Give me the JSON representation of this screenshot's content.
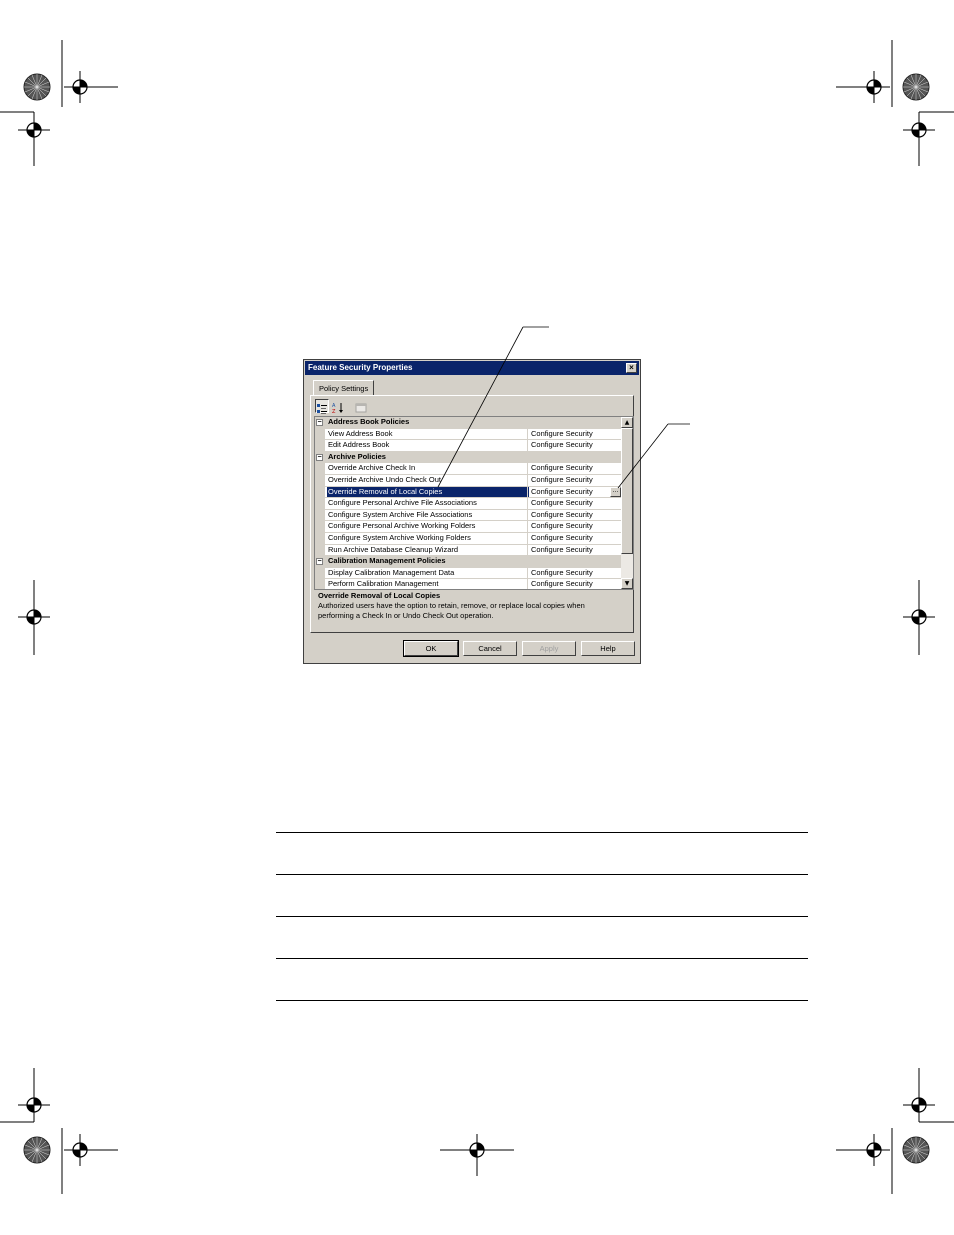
{
  "dialog": {
    "title": "Feature Security Properties",
    "close_glyph": "×",
    "tab_label": "Policy Settings",
    "toolbar": [
      {
        "icon": "categorized-view-icon",
        "active": true
      },
      {
        "icon": "alphabetical-sort-icon",
        "active": false
      },
      {
        "icon": "property-pages-icon",
        "active": false
      }
    ],
    "rows": [
      {
        "type": "category",
        "label": "Address Book Policies",
        "expander": "−"
      },
      {
        "type": "item",
        "label": "View Address Book",
        "value": "Configure Security"
      },
      {
        "type": "item",
        "label": "Edit Address Book",
        "value": "Configure Security"
      },
      {
        "type": "category",
        "label": "Archive Policies",
        "expander": "−"
      },
      {
        "type": "item",
        "label": "Override Archive Check In",
        "value": "Configure Security"
      },
      {
        "type": "item",
        "label": "Override Archive Undo Check Out",
        "value": "Configure Security"
      },
      {
        "type": "item",
        "label": "Override Removal of Local Copies",
        "value": "Configure Security",
        "selected": true
      },
      {
        "type": "item",
        "label": "Configure Personal Archive File Associations",
        "value": "Configure Security"
      },
      {
        "type": "item",
        "label": "Configure System Archive File Associations",
        "value": "Configure Security"
      },
      {
        "type": "item",
        "label": "Configure Personal Archive Working Folders",
        "value": "Configure Security"
      },
      {
        "type": "item",
        "label": "Configure System Archive Working Folders",
        "value": "Configure Security"
      },
      {
        "type": "item",
        "label": "Run Archive Database Cleanup Wizard",
        "value": "Configure Security"
      },
      {
        "type": "category",
        "label": "Calibration Management Policies",
        "expander": "−"
      },
      {
        "type": "item",
        "label": "Display Calibration Management Data",
        "value": "Configure Security"
      },
      {
        "type": "item",
        "label": "Perform Calibration Management",
        "value": "Configure Security"
      }
    ],
    "ellipsis_label": "...",
    "description": {
      "title": "Override Removal of Local Copies",
      "text": "Authorized users have the option to retain, remove, or replace local copies when performing a Check In or Undo Check Out operation."
    },
    "buttons": {
      "ok": "OK",
      "cancel": "Cancel",
      "apply": "Apply",
      "help": "Help"
    }
  }
}
